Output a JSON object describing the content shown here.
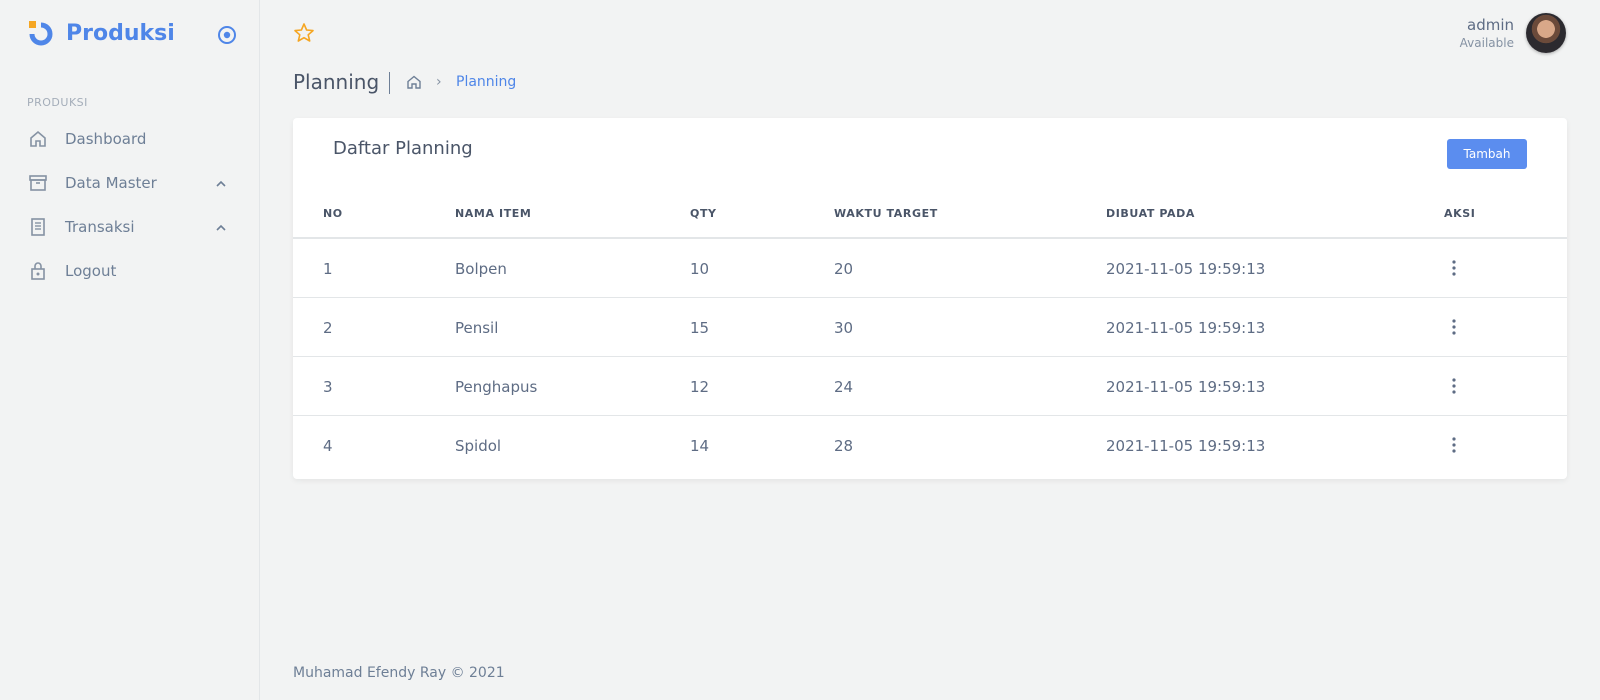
{
  "brand": {
    "name": "Produksi",
    "color": "#4f86e8",
    "accent": "#f5a623"
  },
  "sidebar": {
    "section": "PRODUKSI",
    "items": [
      {
        "label": "Dashboard",
        "icon": "home-icon"
      },
      {
        "label": "Data Master",
        "icon": "archive-icon"
      },
      {
        "label": "Transaksi",
        "icon": "document-icon"
      },
      {
        "label": "Logout",
        "icon": "lock-icon"
      }
    ]
  },
  "topbar": {
    "icon": "star-icon"
  },
  "user": {
    "name": "admin",
    "status": "Available"
  },
  "header": {
    "title": "Planning",
    "breadcrumb": {
      "current": "Planning"
    }
  },
  "card": {
    "title": "Daftar Planning",
    "add_label": "Tambah",
    "columns": [
      "NO",
      "NAMA ITEM",
      "QTY",
      "WAKTU TARGET",
      "DIBUAT PADA",
      "AKSI"
    ],
    "rows": [
      {
        "no": "1",
        "nama": "Bolpen",
        "qty": "10",
        "waktu": "20",
        "dibuat": "2021-11-05 19:59:13"
      },
      {
        "no": "2",
        "nama": "Pensil",
        "qty": "15",
        "waktu": "30",
        "dibuat": "2021-11-05 19:59:13"
      },
      {
        "no": "3",
        "nama": "Penghapus",
        "qty": "12",
        "waktu": "24",
        "dibuat": "2021-11-05 19:59:13"
      },
      {
        "no": "4",
        "nama": "Spidol",
        "qty": "14",
        "waktu": "28",
        "dibuat": "2021-11-05 19:59:13"
      }
    ]
  },
  "footer": {
    "text": "Muhamad Efendy Ray © 2021"
  }
}
